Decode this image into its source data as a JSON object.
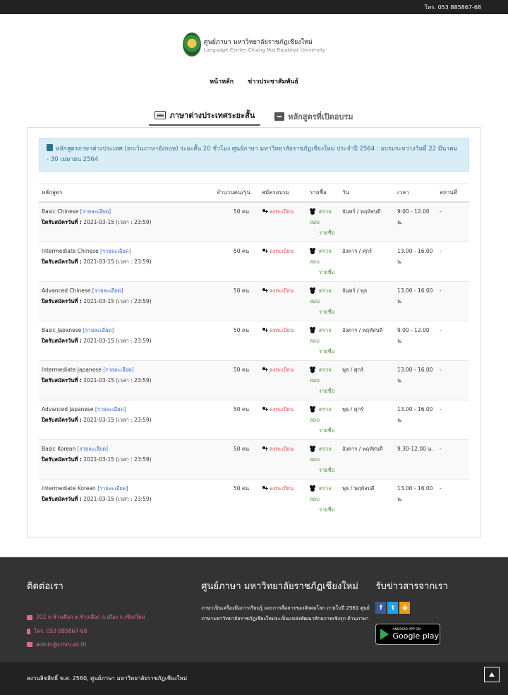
{
  "topbar": {
    "phone": "โทร. 053 885867-68"
  },
  "logo": {
    "title_th": "ศูนย์ภาษา มหาวิทยาลัยราชภัฏเชียงใหม่",
    "title_en": "Language Center Chiang Mai Rajabhat University"
  },
  "nav": {
    "items": [
      "หน้าหลัก",
      "ข่าวประชาสัมพันธ์"
    ]
  },
  "tabs": {
    "active": "ภาษาต่างประเทศระยะสั้น",
    "inactive": "หลักสูตรที่เปิดอบรม"
  },
  "notice": "หลักสูตรภาษาต่างประเทศ (ยกเว้นภาษาอังกฤษ) ระยะสั้น 20 ชั่วโมง ศูนย์ภาษา มหาวิทยาลัยราชภัฏเชียงใหม่ ประจำปี 2564 : อบรมระหว่างวันที่ 22 มีนาคม - 30 เมษายน 2564",
  "table": {
    "headers": [
      "หลักสูตร",
      "จำนวนคน/รุ่น",
      "สมัครอบรม",
      "รายชื่อ",
      "วัน",
      "เวลา",
      "สถานที่"
    ],
    "detail_link": "[รายละเอียด]",
    "deadline_label": "ปิดรับสมัครวันที่ :",
    "register_label": "ลงทะเบียน",
    "check_label": "ตรวจสอบ",
    "check_label2": "รายชื่อ",
    "rows": [
      {
        "course": "Basic Chinese",
        "deadline": "2021-03-15 (เวลา : 23:59)",
        "seats": "50 คน",
        "day": "จันทร์ / พฤหัสบดี",
        "time": "9.00 - 12.00 น.",
        "place": "-"
      },
      {
        "course": "Intermediate Chinese",
        "deadline": "2021-03-15 (เวลา : 23:59)",
        "seats": "50 คน",
        "day": "อังคาร / ศุกร์",
        "time": "13.00 - 16.00 น.",
        "place": "-"
      },
      {
        "course": "Advanced Chinese",
        "deadline": "2021-03-15 (เวลา : 23:59)",
        "seats": "50 คน",
        "day": "จันทร์ / พุธ",
        "time": "13.00 - 16.00 น.",
        "place": "-"
      },
      {
        "course": "Basic Japanese",
        "deadline": "2021-03-15 (เวลา : 23:59)",
        "seats": "50 คน",
        "day": "อังคาร / พฤหัสบดี",
        "time": "9.00 - 12.00 น.",
        "place": "-"
      },
      {
        "course": "Intermediate Japanese",
        "deadline": "2021-03-15 (เวลา : 23:59)",
        "seats": "50 คน",
        "day": "พุธ / ศุกร์",
        "time": "13.00 - 16.00 น.",
        "place": "-"
      },
      {
        "course": "Advanced Japanese",
        "deadline": "2021-03-15 (เวลา : 23:59)",
        "seats": "50 คน",
        "day": "พุธ / ศุกร์",
        "time": "13.00 - 16.00 น.",
        "place": "-"
      },
      {
        "course": "Basic Korean",
        "deadline": "2021-03-15 (เวลา : 23:59)",
        "seats": "50 คน",
        "day": "อังคาร / พฤหัสบดี",
        "time": "9.30-12.00 น.",
        "place": "-"
      },
      {
        "course": "Intermediate Korean",
        "deadline": "2021-03-15 (เวลา : 23:59)",
        "seats": "50 คน",
        "day": "พุธ / พฤหัสบดี",
        "time": "13.00 - 16.00 น.",
        "place": "-"
      }
    ]
  },
  "footer": {
    "contact_title": "ติดต่อเรา",
    "address": "202 ถ.ช้างเผือก ต.ช้างเผือก อ.เมือง จ.เชียงใหม่",
    "phone": "โทร. 053 885867-68",
    "email": "admin@cmru.ac.th",
    "center_title": "ศูนย์ภาษา มหาวิทยาลัยราชภัฏเชียงใหม่",
    "center_text": "ภาษาเป็นเครื่องมือการเรียนรู้ และการสื่อสารของสังคมโลก ภายในปี 2561 ศูนย์ภาษามหาวิทยาลัยราชภัฏเชียงใหม่จะเป็นแหล่งพัฒนาศักยภาพเชิงรุก ด้านภาษา",
    "news_title": "รับข่าวสารจากเรา",
    "social": [
      "f",
      "t",
      "rss"
    ],
    "gplay_small": "ANDROID APP ON",
    "gplay_big": "Google play"
  },
  "bottom": {
    "copyright": "สงวนลิขสิทธิ์ พ.ศ. 2560, ศูนย์ภาษา มหาวิทยาลัยราชภัฏเชียงใหม่"
  }
}
